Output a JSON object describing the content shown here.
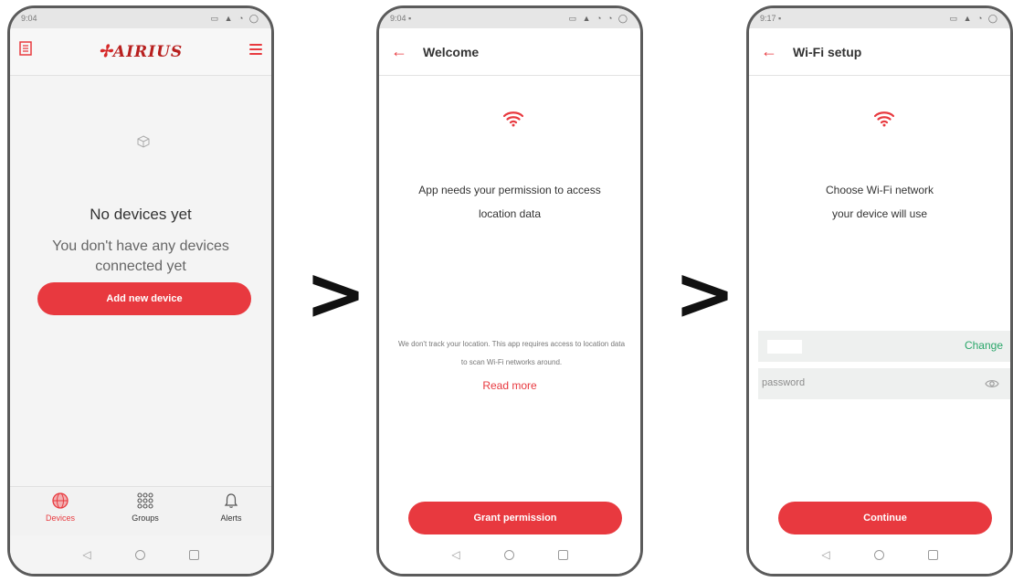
{
  "screen1": {
    "status_time": "9:04",
    "status_icons": "▭ ▲ ◔ ◯",
    "logo_text": "AIRIUS",
    "empty_title": "No devices yet",
    "empty_subtitle": "You don't have any devices connected yet",
    "add_button": "Add new device",
    "tabs": [
      {
        "label": "Devices",
        "active": true
      },
      {
        "label": "Groups",
        "active": false
      },
      {
        "label": "Alerts",
        "active": false
      }
    ]
  },
  "screen2": {
    "status_time": "9:04",
    "status_icons": "▭ ▲ ◔ ◔ ◯",
    "title": "Welcome",
    "message": "App needs your permission to access location data",
    "note": "We don't track your location. This app requires access to location data to scan Wi-Fi networks around.",
    "read_more": "Read more",
    "grant_button": "Grant permission"
  },
  "screen3": {
    "status_time": "9:17",
    "status_icons": "▭ ▲ ◔ ◯",
    "title": "Wi-Fi setup",
    "message": "Choose Wi-Fi network your device will use",
    "change_link": "Change",
    "password_placeholder": "password",
    "continue_button": "Continue"
  },
  "separators": [
    ">",
    ">"
  ],
  "colors": {
    "accent": "#e8393f",
    "link_green": "#2aa66a",
    "appbar": "#ffffff",
    "statusbar": "#e6e6e6"
  }
}
